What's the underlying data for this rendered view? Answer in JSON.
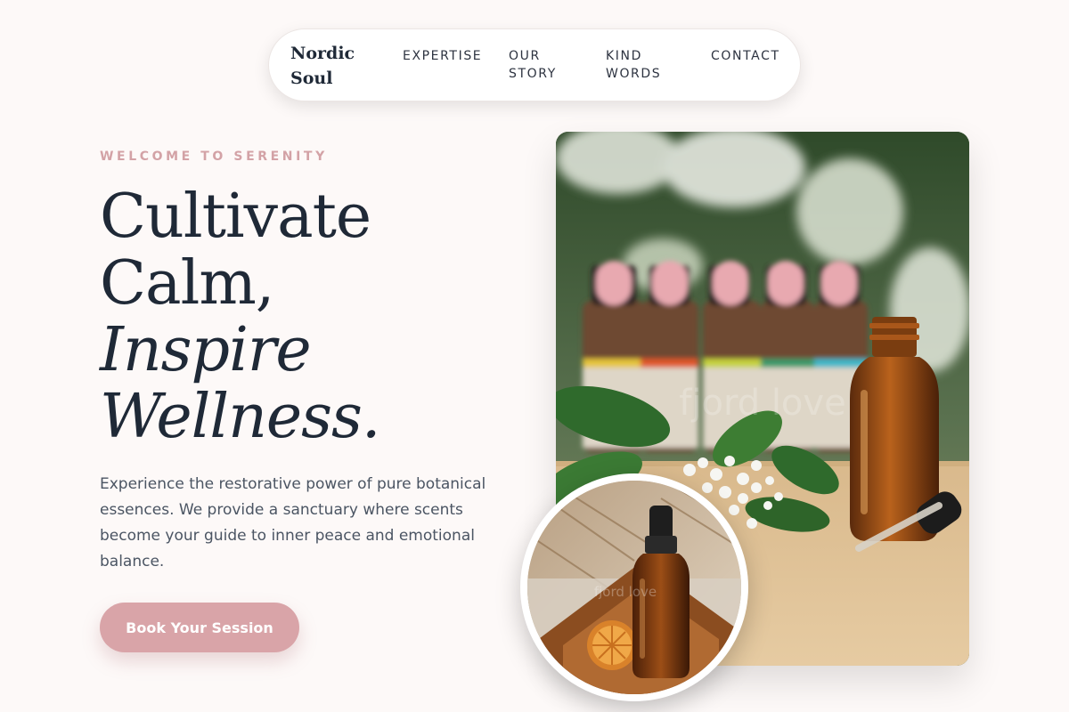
{
  "nav": {
    "brand": "Nordic Soul",
    "items": [
      {
        "label": "EXPERTISE"
      },
      {
        "label": "OUR STORY"
      },
      {
        "label": "KIND WORDS"
      },
      {
        "label": "CONTACT"
      }
    ]
  },
  "hero": {
    "eyebrow": "WELCOME TO SERENITY",
    "headline_line1": "Cultivate",
    "headline_line2": "Calm,",
    "headline_line3": "Inspire",
    "headline_line4": "Wellness.",
    "description": "Experience the restorative power of pure botanical essences. We provide a sanctuary where scents become your guide to inner peace and emotional balance.",
    "cta_label": "Book Your Session"
  },
  "images": {
    "main_watermark": "fjord love",
    "circle_watermark": "fjord love"
  },
  "colors": {
    "background": "#fdf9f8",
    "accent": "#d9a4a8",
    "eyebrow": "#d3a2a6",
    "heading": "#1f2937",
    "body_text": "#4b5563"
  }
}
